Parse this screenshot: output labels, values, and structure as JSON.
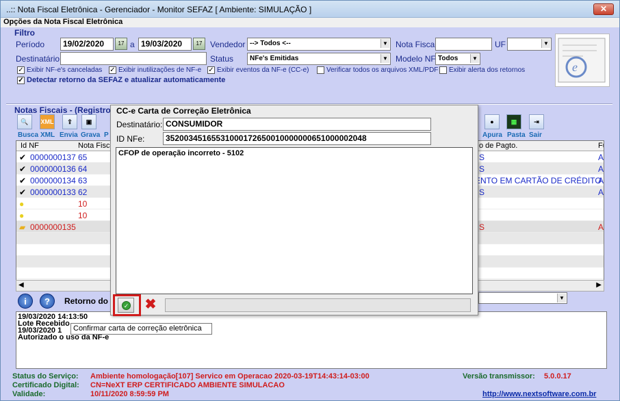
{
  "window": {
    "title": "..:: Nota Fiscal Eletrônica - Gerenciador - Monitor SEFAZ     [ Ambiente: SIMULAÇÃO ]"
  },
  "menubar": {
    "label": "Opções da Nota Fiscal Eletrônica"
  },
  "filtro": {
    "group_title": "Filtro",
    "periodo_label": "Período",
    "periodo_inicio": "19/02/2020",
    "periodo_sep": "a",
    "periodo_fim": "19/03/2020",
    "vendedor_label": "Vendedor",
    "vendedor_value": "--> Todos <--",
    "nota_fiscal_label": "Nota Fiscal",
    "uf_label": "UF",
    "destinatario_label": "Destinatário",
    "status_label": "Status",
    "status_value": "NFe's Emitidas",
    "modelo_label": "Modelo NF",
    "modelo_value": "Todos",
    "checks": [
      {
        "label": "Exibir NF-e's canceladas",
        "checked": true
      },
      {
        "label": "Exibir inutilizações de NF-e",
        "checked": true
      },
      {
        "label": "Exibir eventos da NF-e (CC-e)",
        "checked": true
      },
      {
        "label": "Verificar todos os arquivos XML/PDF",
        "checked": false
      },
      {
        "label": "Exibir alerta dos retornos",
        "checked": false
      }
    ],
    "detect_label": "Detectar retorno da SEFAZ e atualizar automaticamente"
  },
  "notas": {
    "group_title": "Notas Fiscais - (Registros",
    "toolbar_left": [
      "Busca",
      "XML",
      "Envia",
      "Grava",
      "P"
    ],
    "toolbar_right": [
      "Apura",
      "Pasta",
      "Sair"
    ],
    "xml_icon_label": "XML",
    "col_id": "Id NF",
    "col_nota": "Nota Fiscal",
    "col_pagto": "o de Pagto.",
    "col_f": "Fu",
    "rows": [
      {
        "id": "0000000137",
        "nota": "65",
        "pagto": "S",
        "f": "A"
      },
      {
        "id": "0000000136",
        "nota": "64",
        "pagto": "S",
        "f": "A"
      },
      {
        "id": "0000000134",
        "nota": "63",
        "pagto": "ENTO EM CARTÃO DE CRÉDITO",
        "f": "A"
      },
      {
        "id": "0000000133",
        "nota": "62",
        "pagto": "S",
        "f": "A"
      },
      {
        "id": "",
        "nota": "10",
        "pagto": "",
        "f": ""
      },
      {
        "id": "",
        "nota": "10",
        "pagto": "",
        "f": ""
      },
      {
        "id": "0000000135",
        "nota": "",
        "pagto": "S",
        "f": "A"
      }
    ],
    "retorno_label": "Retorno do"
  },
  "dialog": {
    "title": "CC-e Carta de Correção Eletrônica",
    "destinatario_label": "Destinatário:",
    "destinatario_value": "CONSUMIDOR",
    "id_label": "ID NFe:",
    "id_value": "35200345165531000172650010000000651000002048",
    "memo_text": "CFOP de operação incorreto - 5102",
    "tooltip": "Confirmar carta de correção eletrônica"
  },
  "status_log": [
    "19/03/2020 14:13:50",
    "Lote Recebido",
    "19/03/2020 1",
    "Autorizado o uso da NF-e"
  ],
  "footer": {
    "servico_label": "Status do Serviço:",
    "servico_value": "Ambiente homologação[107] Servico em Operacao 2020-03-19T14:43:14-03:00",
    "certificado_label": "Certificado Digital:",
    "certificado_value": "CN=NeXT ERP CERTIFICADO AMBIENTE SIMULACAO",
    "validade_label": "Validade:",
    "validade_value": "10/11/2020 8:59:59 PM",
    "versao_label": "Versão transmissor:",
    "versao_value": "5.0.0.17",
    "link": "http://www.nextsoftware.com.br"
  },
  "colors": {
    "label_blue": "#1a2a8c",
    "footer_green": "#1a6a2c",
    "footer_red": "#d01c1c",
    "highlight": "#d01c1c"
  }
}
